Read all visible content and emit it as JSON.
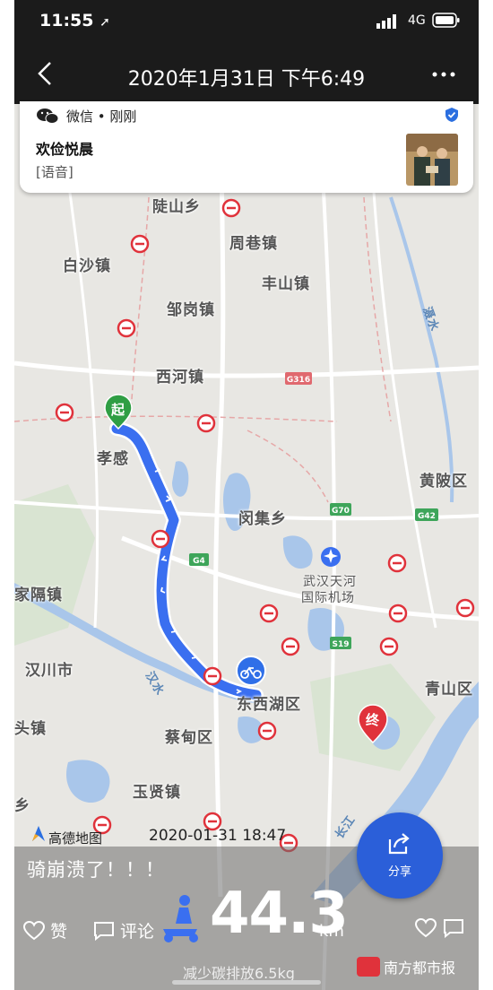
{
  "status_bar": {
    "time": "11:55",
    "network": "4G"
  },
  "header": {
    "title": "2020年1月31日 下午6:49"
  },
  "notification": {
    "app": "微信 • 刚刚",
    "sender": "欢俭悦晨",
    "message": "[语音]"
  },
  "map": {
    "labels": [
      "陡山乡",
      "周巷镇",
      "白沙镇",
      "丰山镇",
      "邹岗镇",
      "西河镇",
      "孝感",
      "黄陂区",
      "闵集乡",
      "武汉天河",
      "国际机场",
      "家隔镇",
      "汉川市",
      "东西湖区",
      "青山区",
      "蔡甸区",
      "玉贤镇",
      "头镇",
      "乡"
    ],
    "rivers": [
      "滠水",
      "汉水",
      "长江"
    ],
    "road_shields": [
      "G316",
      "G70",
      "G42",
      "G4",
      "S19"
    ],
    "start_marker": "起",
    "end_marker": "终"
  },
  "route_info": {
    "brand": "高德地图",
    "datetime": "2020-01-31 18:47",
    "caption": "骑崩溃了！！！",
    "distance": "44.3",
    "unit": "km",
    "carbon": "减少碳排放6.5kg",
    "like_label": "赞",
    "comment_label": "评论",
    "share_label": "分享"
  },
  "watermark": "南方都市报",
  "colors": {
    "route": "#3a6ff0",
    "start": "#2f9e44",
    "end": "#e0323b",
    "share": "#2b5fd9"
  }
}
